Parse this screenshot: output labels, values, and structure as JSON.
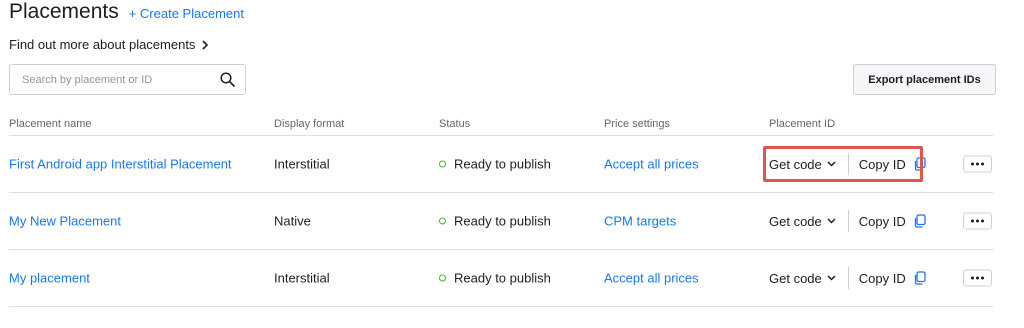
{
  "header": {
    "title": "Placements",
    "create_link": "+ Create Placement",
    "find_more": "Find out more about placements"
  },
  "search": {
    "placeholder": "Search by placement or ID",
    "value": ""
  },
  "toolbar": {
    "export_label": "Export placement IDs"
  },
  "table": {
    "columns": [
      "Placement name",
      "Display format",
      "Status",
      "Price settings",
      "Placement ID"
    ],
    "rows": [
      {
        "name": "First Android app Interstitial Placement",
        "format": "Interstitial",
        "status": "Ready to publish",
        "price": "Accept all prices",
        "get_code": "Get code",
        "copy_id": "Copy ID"
      },
      {
        "name": "My New Placement",
        "format": "Native",
        "status": "Ready to publish",
        "price": "CPM targets",
        "get_code": "Get code",
        "copy_id": "Copy ID"
      },
      {
        "name": "My placement",
        "format": "Interstitial",
        "status": "Ready to publish",
        "price": "Accept all prices",
        "get_code": "Get code",
        "copy_id": "Copy ID"
      }
    ]
  },
  "colors": {
    "link": "#1877f2",
    "status_ok": "#42b72a",
    "highlight": "#e0544e",
    "text": "#1c1e21",
    "muted": "#606770"
  },
  "icons": {
    "search": "search-icon",
    "chevron_right": "chevron-right-icon",
    "chevron_down": "chevron-down-icon",
    "copy": "copy-icon",
    "more": "more-options-icon"
  }
}
